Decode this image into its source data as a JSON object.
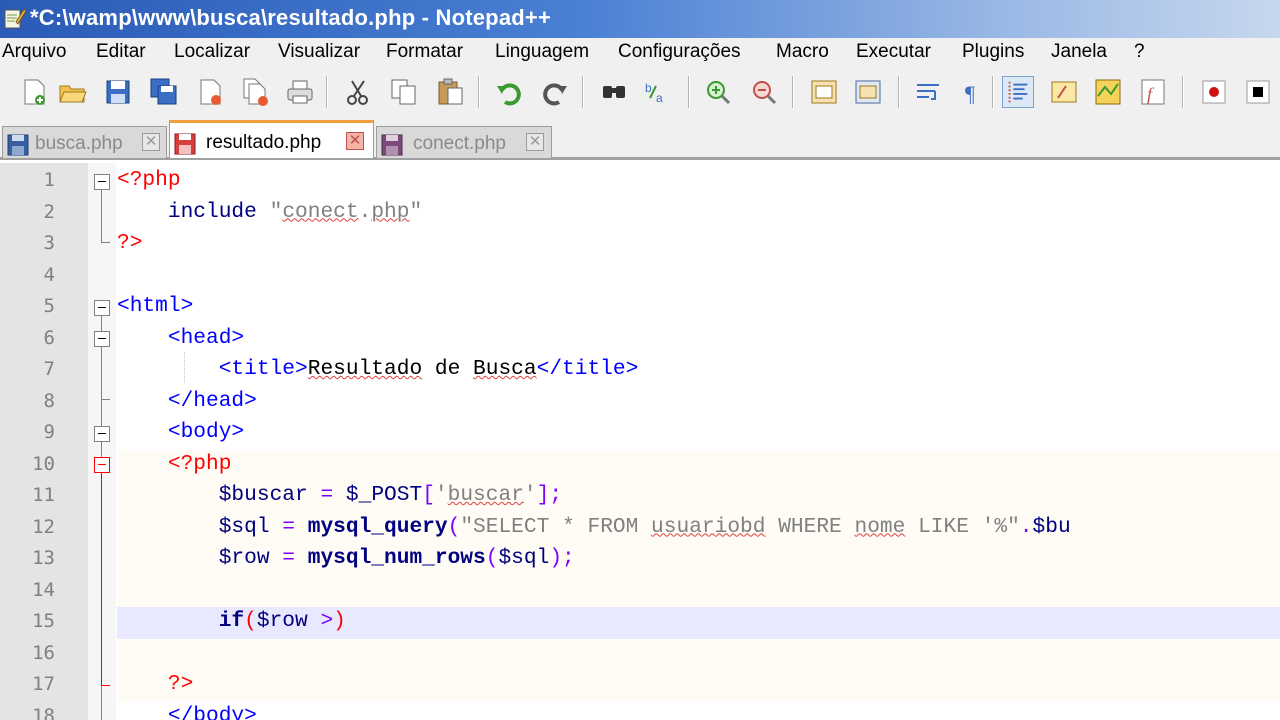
{
  "window": {
    "title": "*C:\\wamp\\www\\busca\\resultado.php - Notepad++"
  },
  "menu": [
    "Arquivo",
    "Editar",
    "Localizar",
    "Visualizar",
    "Formatar",
    "Linguagem",
    "Configurações",
    "Macro",
    "Executar",
    "Plugins",
    "Janela",
    "?"
  ],
  "toolbar": [
    "new-file-icon",
    "open-folder-icon",
    "save-icon",
    "save-all-icon",
    "close-icon",
    "close-all-icon",
    "print-icon",
    "cut-icon",
    "copy-icon",
    "paste-icon",
    "undo-icon",
    "redo-icon",
    "find-icon",
    "replace-icon",
    "zoom-in-icon",
    "zoom-out-icon",
    "sync-v-icon",
    "sync-h-icon",
    "word-wrap-icon",
    "show-all-chars-icon",
    "indent-guide-icon",
    "user-lang-icon",
    "doc-map-icon",
    "function-list-icon",
    "record-macro-icon",
    "stop-record-icon"
  ],
  "tabs": [
    {
      "label": "busca.php",
      "active": false,
      "modified": false
    },
    {
      "label": "resultado.php",
      "active": true,
      "modified": true
    },
    {
      "label": "conect.php",
      "active": false,
      "modified": false
    }
  ],
  "editor": {
    "lines": [
      {
        "n": "1",
        "text": "<?php"
      },
      {
        "n": "2",
        "text": "    include \"conect.php\""
      },
      {
        "n": "3",
        "text": "?>"
      },
      {
        "n": "4",
        "text": ""
      },
      {
        "n": "5",
        "text": "<html>"
      },
      {
        "n": "6",
        "text": "    <head>"
      },
      {
        "n": "7",
        "text": "        <title>Resultado de Busca</title>"
      },
      {
        "n": "8",
        "text": "    </head>"
      },
      {
        "n": "9",
        "text": "    <body>"
      },
      {
        "n": "10",
        "text": "    <?php"
      },
      {
        "n": "11",
        "text": "        $buscar = $_POST['buscar'];"
      },
      {
        "n": "12",
        "text": "        $sql = mysql_query(\"SELECT * FROM usuariobd WHERE nome LIKE '%\".$bu"
      },
      {
        "n": "13",
        "text": "        $row = mysql_num_rows($sql);"
      },
      {
        "n": "14",
        "text": ""
      },
      {
        "n": "15",
        "text": "        if($row >)"
      },
      {
        "n": "16",
        "text": ""
      },
      {
        "n": "17",
        "text": "    ?>"
      },
      {
        "n": "18",
        "text": "    </body>"
      }
    ],
    "current_line": 15
  },
  "colors": {
    "php_delim": "#ff0000",
    "html_tag": "#0000ff",
    "keyword": "#000080",
    "string": "#808080",
    "operator": "#8000ff",
    "current_line_bg": "#e8e8ff"
  }
}
